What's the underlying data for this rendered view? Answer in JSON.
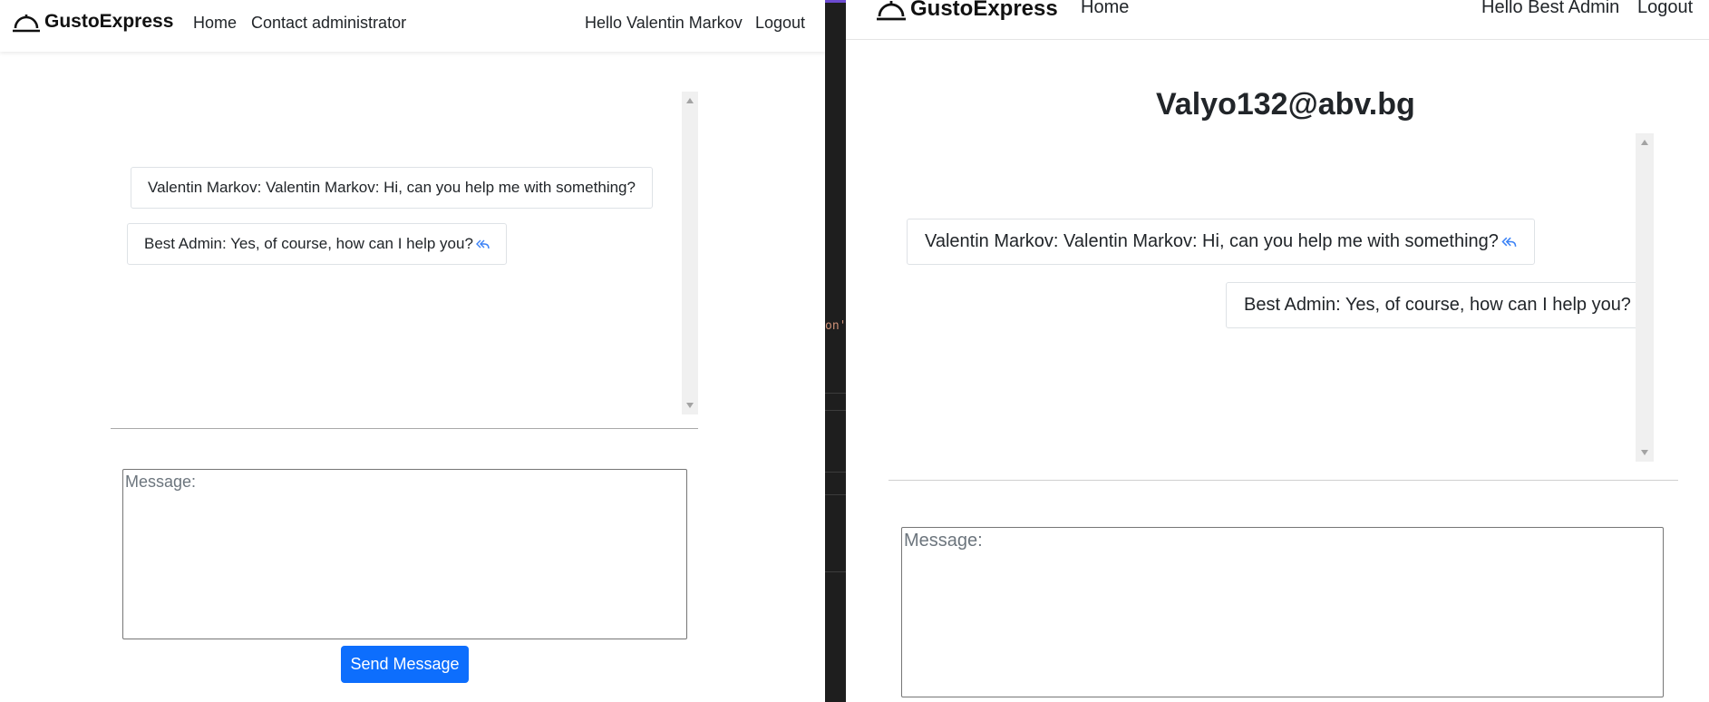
{
  "left": {
    "navbar": {
      "brand": "GustoExpress",
      "links": [
        "Home",
        "Contact administrator"
      ],
      "greeting": "Hello Valentin Markov",
      "logout": "Logout"
    },
    "messages": [
      {
        "text": "Valentin Markov: Valentin Markov: Hi, can you help me with something?",
        "reply_icon": false
      },
      {
        "text": "Best Admin: Yes, of course, how can I help you?",
        "reply_icon": true
      }
    ],
    "input": {
      "placeholder": "Message:",
      "value": ""
    },
    "send_label": "Send Message"
  },
  "right": {
    "navbar": {
      "brand": "GustoExpress",
      "links": [
        "Home"
      ],
      "greeting": "Hello Best Admin",
      "logout": "Logout"
    },
    "chat_title": "Valyo132@abv.bg",
    "messages": [
      {
        "text": "Valentin Markov: Valentin Markov: Hi, can you help me with something?",
        "reply_icon": true
      },
      {
        "text": "Best Admin: Yes, of course, how can I help you?",
        "reply_icon": false
      }
    ],
    "input": {
      "placeholder": "Message:",
      "value": ""
    }
  },
  "background_snippet": "on'",
  "colors": {
    "accent": "#0d6efd",
    "reply_icon": "#3b82f6",
    "editor_bg": "#1e1e1e",
    "editor_accent": "#6c4bd1"
  }
}
